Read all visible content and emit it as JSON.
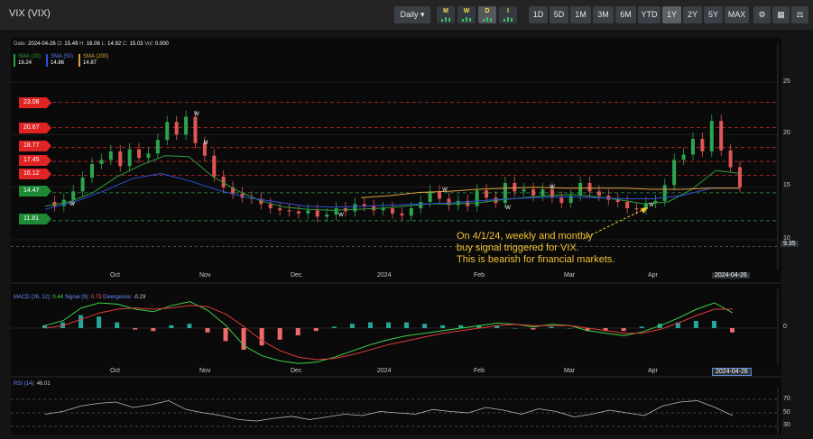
{
  "header": {
    "title": "VIX (VIX)",
    "interval_dropdown": "Daily",
    "freq_buttons": [
      {
        "letter": "M",
        "active": false
      },
      {
        "letter": "W",
        "active": false
      },
      {
        "letter": "D",
        "active": true
      },
      {
        "letter": "I",
        "active": false
      }
    ],
    "ranges": [
      "1D",
      "5D",
      "1M",
      "3M",
      "6M",
      "YTD",
      "1Y",
      "2Y",
      "5Y",
      "MAX"
    ],
    "active_range": "1Y",
    "tool_icons": [
      "settings-icon",
      "calculator-icon",
      "scale-icon"
    ]
  },
  "ohlc": {
    "date_label": "Date:",
    "date": "2024-04-26",
    "o_label": "O:",
    "o": "15.49",
    "h_label": "H:",
    "h": "16.06",
    "l_label": "L:",
    "l": "14.92",
    "c_label": "C:",
    "c": "15.03",
    "vol_label": "Vol:",
    "vol": "0.000"
  },
  "sma": [
    {
      "label": "SMA (20)",
      "value": "16.24",
      "color": "#2e9e3e"
    },
    {
      "label": "SMA (50)",
      "value": "14.86",
      "color": "#2f50d8"
    },
    {
      "label": "SMA (200)",
      "value": "14.87",
      "color": "#e0a040"
    }
  ],
  "levels": [
    {
      "value": "23.08",
      "color": "red"
    },
    {
      "value": "20.67",
      "color": "red"
    },
    {
      "value": "18.77",
      "color": "red"
    },
    {
      "value": "17.45",
      "color": "red"
    },
    {
      "value": "16.12",
      "color": "red"
    },
    {
      "value": "14.47",
      "color": "green"
    },
    {
      "value": "11.81",
      "color": "green"
    }
  ],
  "price_axis": [
    "25",
    "20",
    "15",
    "10"
  ],
  "current_low_label": "9.35",
  "x_axis": [
    "Oct",
    "Nov",
    "Dec",
    "2024",
    "Feb",
    "Mar",
    "Apr"
  ],
  "date_marker": "2024-04-26",
  "annotation": [
    "On 4/1/24, weekly and monthly",
    "buy signal triggered for VIX.",
    "This is bearish for financial markets."
  ],
  "macd": {
    "label": "MACD (26, 12):",
    "value": "0.44",
    "signal_label": "Signal (9):",
    "signal": "0.73",
    "div_label": "Divergence:",
    "div": "-0.29",
    "axis_zero": "0"
  },
  "rsi": {
    "label": "RSI (14):",
    "value": "46.01",
    "levels": [
      "70",
      "50",
      "30"
    ]
  },
  "signals": {
    "weekly": "W",
    "monthly": "M"
  },
  "colors": {
    "up": "#2ea44f",
    "down": "#e05555",
    "accent": "#f2c232",
    "macd_up": "#26a69a",
    "macd_down": "#ef6b6b"
  },
  "chart_data": {
    "type": "line",
    "title": "VIX (VIX)",
    "price_ylim": [
      9.35,
      25
    ],
    "x_month_ticks": [
      "Oct",
      "Nov",
      "Dec",
      "2024",
      "Feb",
      "Mar",
      "Apr"
    ],
    "close_approx": [
      13.6,
      13.2,
      13.8,
      14.6,
      15.9,
      17.2,
      17.6,
      18.4,
      17.0,
      18.6,
      17.8,
      18.2,
      19.5,
      21.2,
      20.0,
      21.7,
      19.2,
      18.0,
      16.0,
      15.0,
      14.4,
      14.0,
      13.9,
      13.4,
      13.0,
      12.8,
      12.7,
      12.5,
      12.8,
      12.2,
      12.4,
      13.0,
      12.7,
      13.4,
      13.2,
      12.8,
      13.0,
      12.5,
      12.3,
      13.0,
      13.6,
      14.6,
      13.9,
      13.3,
      13.7,
      13.2,
      14.7,
      14.0,
      13.5,
      15.4,
      14.6,
      14.8,
      14.2,
      14.8,
      14.0,
      13.5,
      14.2,
      15.4,
      14.6,
      14.2,
      13.8,
      13.6,
      13.0,
      12.9,
      13.5,
      13.7,
      15.2,
      17.6,
      18.1,
      19.6,
      18.4,
      21.3,
      18.5,
      16.9,
      15.0
    ],
    "sma20_approx": [
      13.2,
      13.6,
      14.5,
      16.0,
      17.1,
      18.0,
      17.9,
      16.0,
      14.7,
      13.7,
      13.1,
      12.9,
      12.8,
      12.9,
      13.0,
      13.2,
      13.4,
      13.4,
      13.5,
      13.8,
      14.0,
      14.2,
      14.3,
      14.1,
      13.8,
      13.4,
      13.6,
      14.8,
      16.6,
      16.3
    ],
    "sma50_approx": [
      12.9,
      13.6,
      14.6,
      15.8,
      16.3,
      15.6,
      14.7,
      14.0,
      13.6,
      13.2,
      13.1,
      13.2,
      13.3,
      13.4,
      13.5,
      13.7,
      13.9,
      14.0,
      14.1,
      14.0,
      13.9,
      13.9,
      14.2,
      14.9,
      14.9
    ],
    "sma200_approx": [
      14.0,
      14.2,
      14.5,
      14.6,
      14.8,
      14.9,
      15.0,
      14.9,
      14.9,
      14.9,
      14.8,
      14.8,
      14.9,
      14.9
    ],
    "macd_ylim": [
      -3.2,
      2.6
    ],
    "rsi_ylim": [
      25,
      75
    ]
  }
}
